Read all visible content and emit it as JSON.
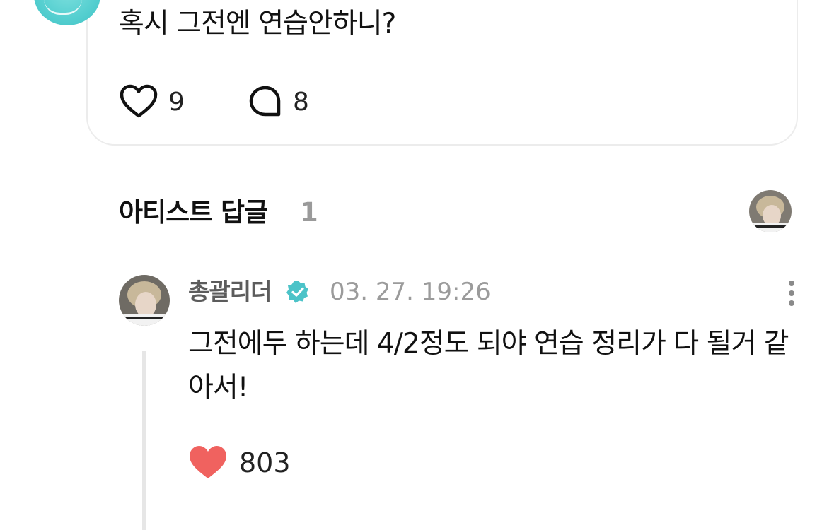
{
  "post": {
    "text": "혹시 그전엔 연습안하니?",
    "likes": "9",
    "comments": "8",
    "like_icon": "heart-outline-icon",
    "comment_icon": "speech-bubble-icon",
    "avatar_color": "#55cfd0"
  },
  "artist_replies": {
    "title": "아티스트 답글",
    "count": "1"
  },
  "reply": {
    "author": "총괄리더",
    "verified_icon": "verified-badge-icon",
    "timestamp": "03. 27. 19:26",
    "text": "그전에두 하는데 4/2정도 되야 연습 정리가 다 될거 같아서!",
    "likes": "803",
    "like_icon": "heart-filled-icon",
    "like_color": "#f0625f",
    "badge_color": "#4cc3c8"
  }
}
